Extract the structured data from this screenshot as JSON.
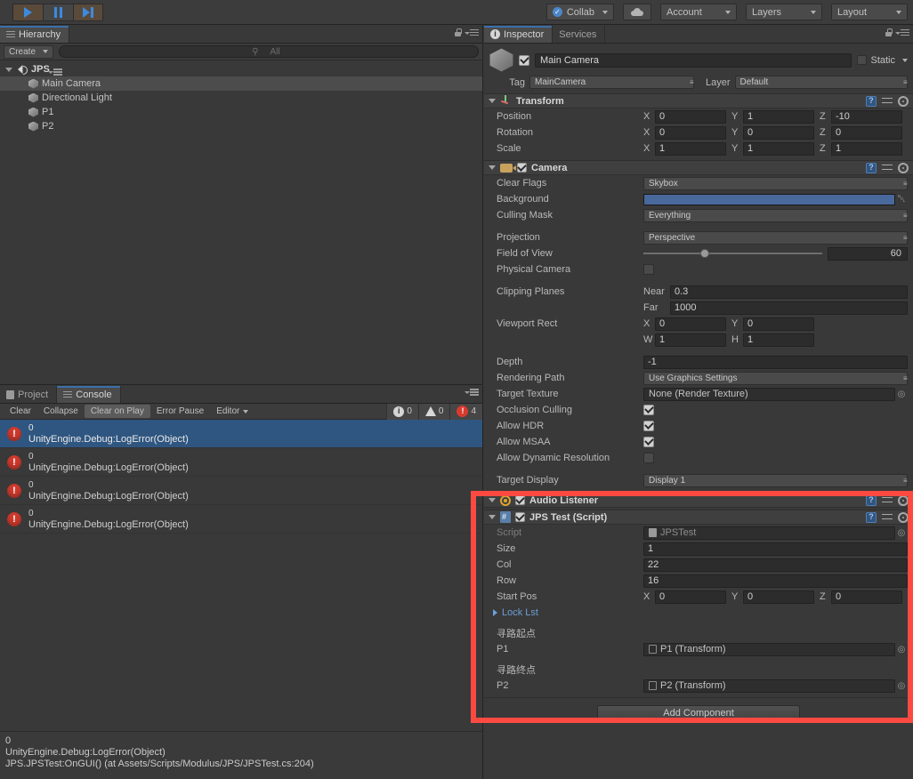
{
  "toolbar": {
    "play_icon": "play-icon",
    "pause_icon": "pause-icon",
    "step_icon": "step-icon",
    "collab_label": "Collab",
    "cloud_icon": "cloud-icon",
    "account_label": "Account",
    "layers_label": "Layers",
    "layout_label": "Layout"
  },
  "hierarchy": {
    "tab_label": "Hierarchy",
    "tab_icon": "hierarchy-icon",
    "create_label": "Create",
    "search_placeholder": "All",
    "search_value": "",
    "items": [
      {
        "label": "JPS",
        "icon": "scene-icon",
        "depth": 0,
        "selected": false,
        "expanded": true
      },
      {
        "label": "Main Camera",
        "icon": "gameobject-icon",
        "depth": 1,
        "selected": true
      },
      {
        "label": "Directional Light",
        "icon": "gameobject-icon",
        "depth": 1,
        "selected": false
      },
      {
        "label": "P1",
        "icon": "gameobject-icon",
        "depth": 1,
        "selected": false
      },
      {
        "label": "P2",
        "icon": "gameobject-icon",
        "depth": 1,
        "selected": false
      }
    ]
  },
  "console": {
    "project_tab": "Project",
    "console_tab": "Console",
    "clear_label": "Clear",
    "collapse_label": "Collapse",
    "clear_on_play_label": "Clear on Play",
    "error_pause_label": "Error Pause",
    "editor_label": "Editor",
    "info_count": "0",
    "warning_count": "0",
    "error_count": "4",
    "rows": [
      {
        "line1": "0",
        "line2": "UnityEngine.Debug:LogError(Object)",
        "selected": true
      },
      {
        "line1": "0",
        "line2": "UnityEngine.Debug:LogError(Object)",
        "selected": false
      },
      {
        "line1": "0",
        "line2": "UnityEngine.Debug:LogError(Object)",
        "selected": false
      },
      {
        "line1": "0",
        "line2": "UnityEngine.Debug:LogError(Object)",
        "selected": false
      }
    ],
    "detail": {
      "line1": "0",
      "line2": "UnityEngine.Debug:LogError(Object)",
      "line3": "JPS.JPSTest:OnGUI() (at Assets/Scripts/Modulus/JPS/JPSTest.cs:204)"
    }
  },
  "inspector": {
    "tab_label": "Inspector",
    "services_tab_label": "Services",
    "object_name": "Main Camera",
    "object_enabled": true,
    "static_label": "Static",
    "tag_label": "Tag",
    "tag_value": "MainCamera",
    "layer_label": "Layer",
    "layer_value": "Default",
    "transform": {
      "title": "Transform",
      "position_label": "Position",
      "position": {
        "x": "0",
        "y": "1",
        "z": "-10"
      },
      "rotation_label": "Rotation",
      "rotation": {
        "x": "0",
        "y": "0",
        "z": "0"
      },
      "scale_label": "Scale",
      "scale": {
        "x": "1",
        "y": "1",
        "z": "1"
      }
    },
    "camera": {
      "title": "Camera",
      "enabled": true,
      "clear_flags_label": "Clear Flags",
      "clear_flags_value": "Skybox",
      "background_label": "Background",
      "background_color": "#49689c",
      "culling_mask_label": "Culling Mask",
      "culling_mask_value": "Everything",
      "projection_label": "Projection",
      "projection_value": "Perspective",
      "fov_label": "Field of View",
      "fov_value": "60",
      "physical_camera_label": "Physical Camera",
      "physical_camera_checked": false,
      "clipping_planes_label": "Clipping Planes",
      "near_label": "Near",
      "near_value": "0.3",
      "far_label": "Far",
      "far_value": "1000",
      "viewport_rect_label": "Viewport Rect",
      "viewport": {
        "x": "0",
        "y": "0",
        "w": "1",
        "h": "1"
      },
      "depth_label": "Depth",
      "depth_value": "-1",
      "rendering_path_label": "Rendering Path",
      "rendering_path_value": "Use Graphics Settings",
      "target_texture_label": "Target Texture",
      "target_texture_value": "None (Render Texture)",
      "occlusion_culling_label": "Occlusion Culling",
      "occlusion_culling_checked": true,
      "allow_hdr_label": "Allow HDR",
      "allow_hdr_checked": true,
      "allow_msaa_label": "Allow MSAA",
      "allow_msaa_checked": true,
      "allow_dynamic_resolution_label": "Allow Dynamic Resolution",
      "allow_dynamic_resolution_checked": false,
      "target_display_label": "Target Display",
      "target_display_value": "Display 1"
    },
    "audio_listener": {
      "title": "Audio Listener",
      "enabled": true
    },
    "jps_test": {
      "title": "JPS Test (Script)",
      "enabled": true,
      "script_label": "Script",
      "script_value": "JPSTest",
      "size_label": "Size",
      "size_value": "1",
      "col_label": "Col",
      "col_value": "22",
      "row_label": "Row",
      "row_value": "16",
      "start_pos_label": "Start Pos",
      "start_pos": {
        "x": "0",
        "y": "0",
        "z": "0"
      },
      "lock_lst_label": "Lock Lst",
      "p1_header": "寻路起点",
      "p1_label": "P1",
      "p1_value": "P1 (Transform)",
      "p2_header": "寻路终点",
      "p2_label": "P2",
      "p2_value": "P2 (Transform)"
    },
    "add_component_label": "Add Component"
  },
  "highlight": {
    "color": "#fd4a41"
  }
}
